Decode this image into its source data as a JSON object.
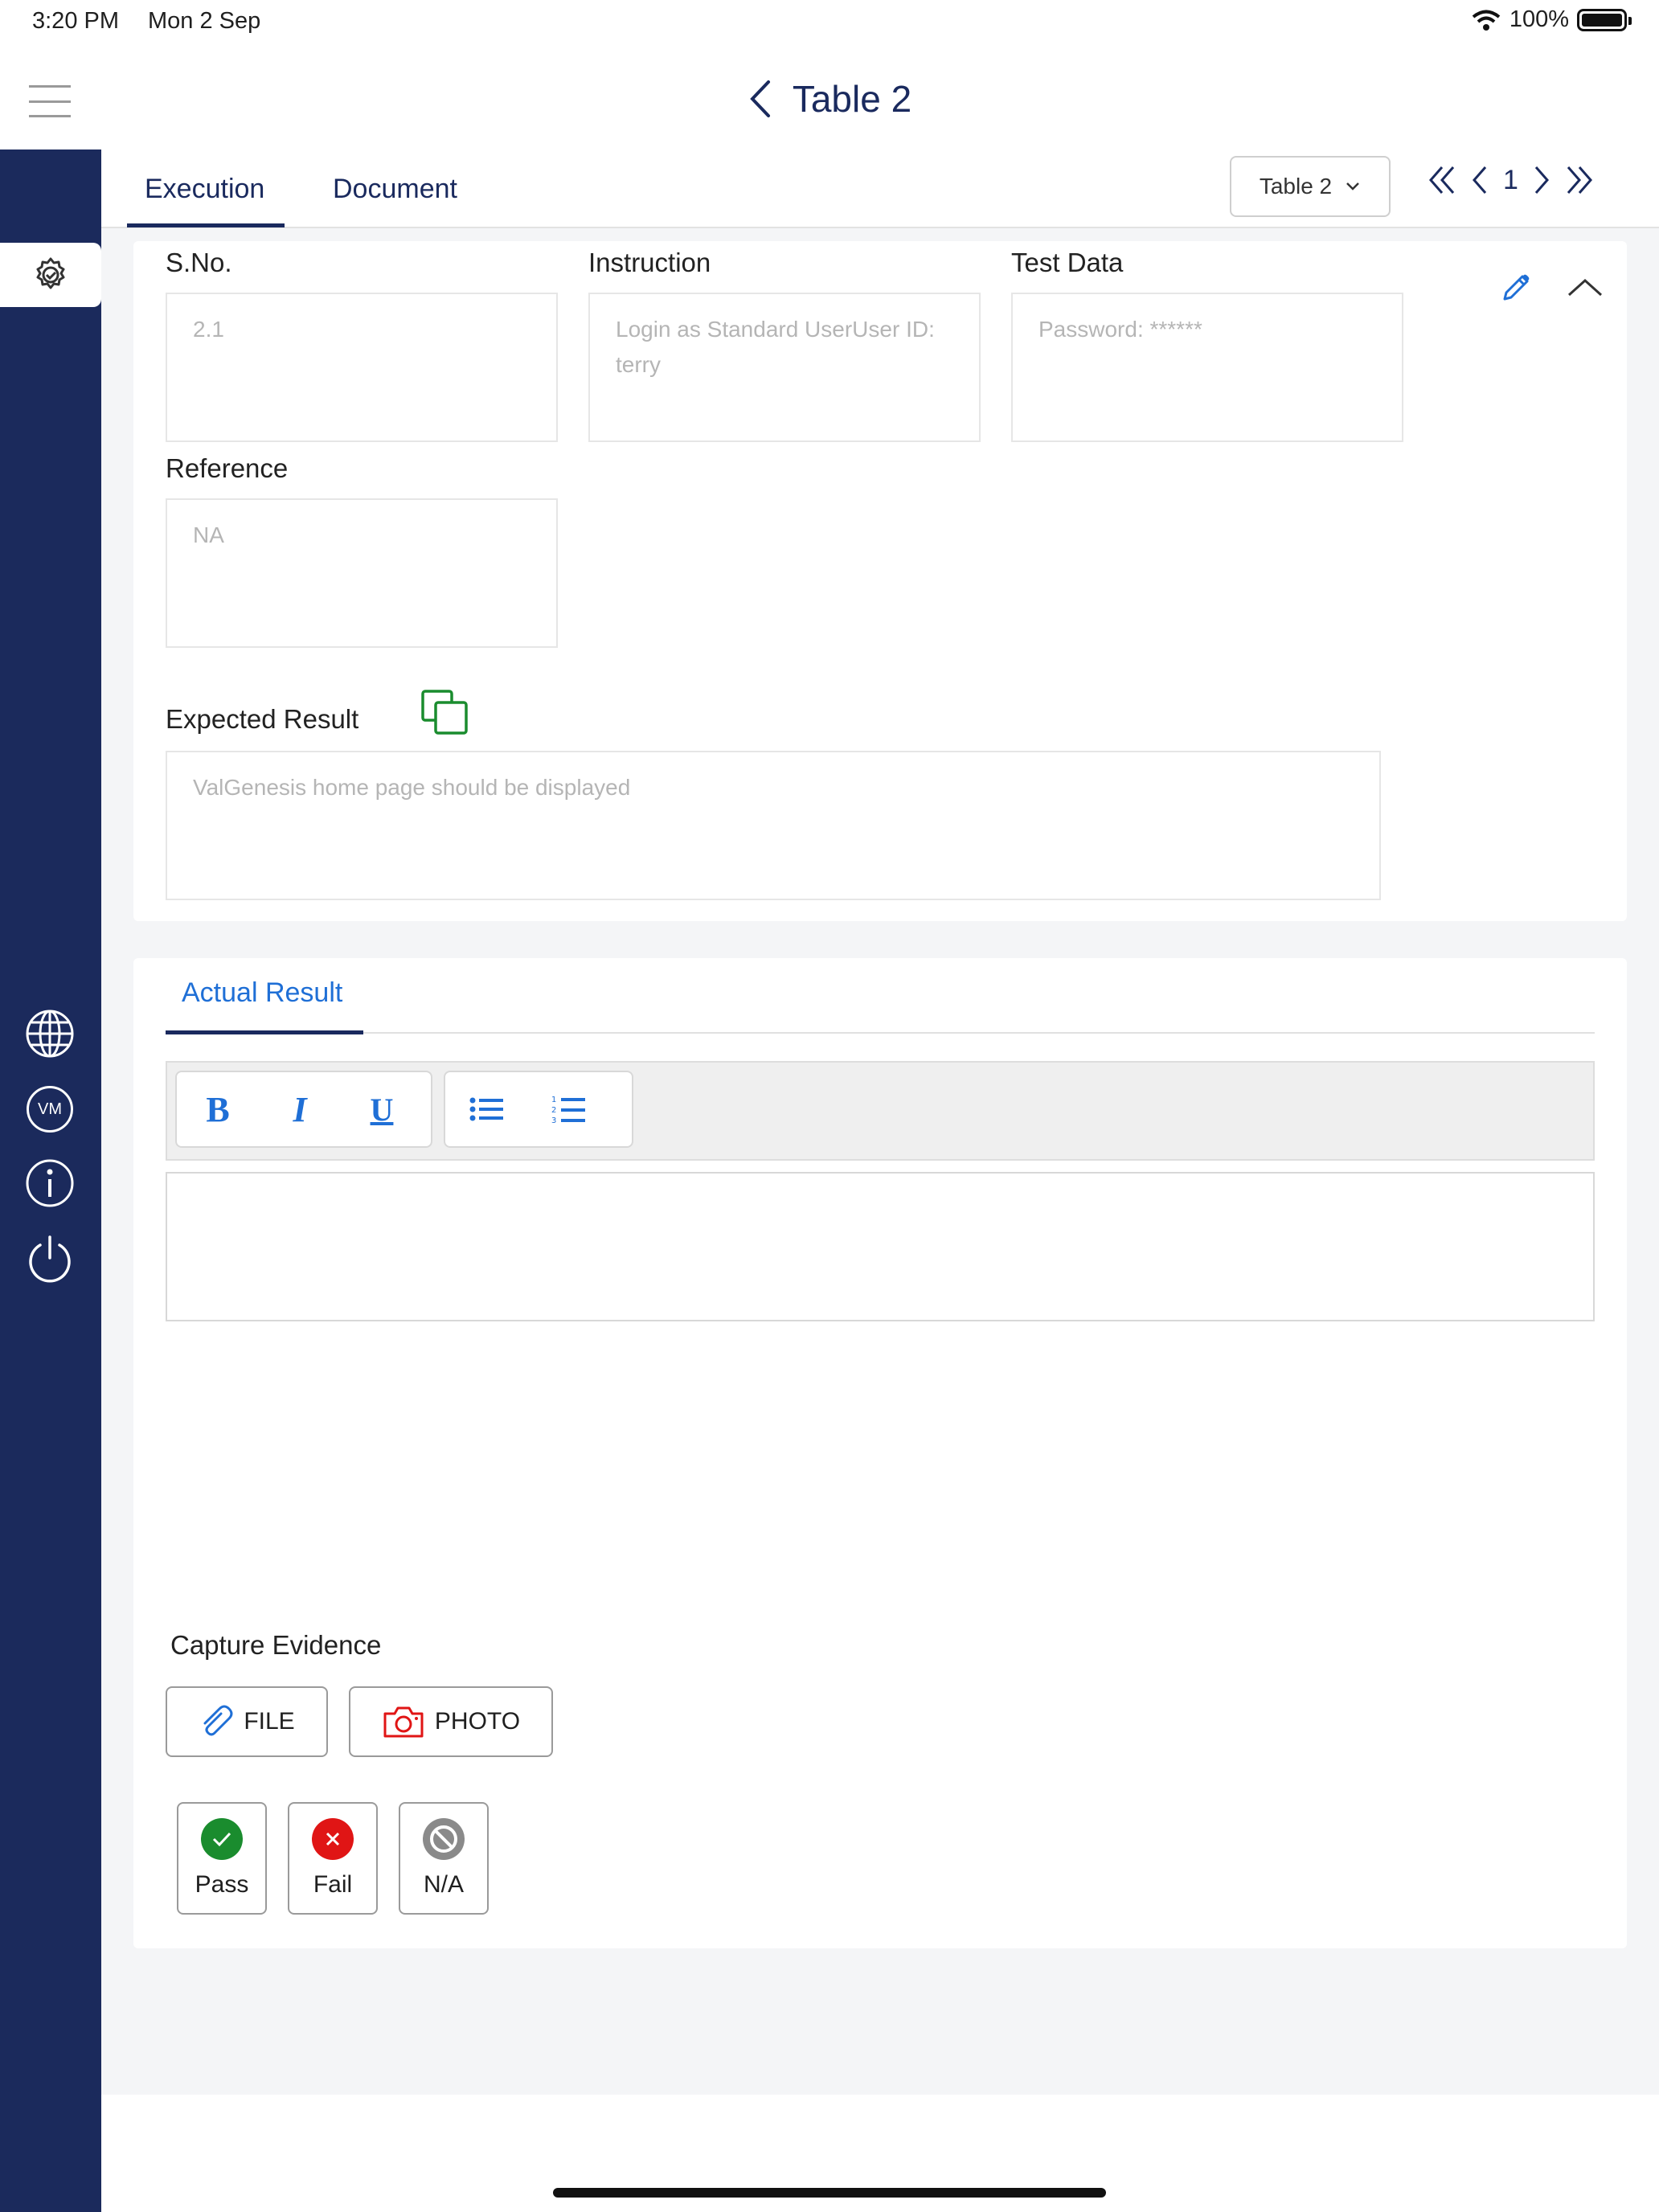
{
  "status_bar": {
    "time": "3:20 PM",
    "date": "Mon 2 Sep",
    "battery": "100%"
  },
  "nav": {
    "title": "Table 2"
  },
  "tabs": [
    {
      "label": "Execution"
    },
    {
      "label": "Document"
    }
  ],
  "table_select": {
    "value": "Table 2"
  },
  "pager": {
    "page": "1"
  },
  "step": {
    "sno_label": "S.No.",
    "sno_value": "2.1",
    "instruction_label": "Instruction",
    "instruction_value": "Login as Standard UserUser ID: terry",
    "test_data_label": "Test Data",
    "test_data_value": "Password: ******",
    "reference_label": "Reference",
    "reference_value": "NA",
    "expected_label": "Expected Result",
    "expected_value": "ValGenesis home page should be displayed"
  },
  "actual_result": {
    "tab_label": "Actual Result",
    "toolbar": {
      "bold": "B",
      "italic": "I",
      "underline": "U"
    },
    "editor_value": ""
  },
  "evidence": {
    "label": "Capture Evidence",
    "file_label": "FILE",
    "photo_label": "PHOTO"
  },
  "result_buttons": {
    "pass": "Pass",
    "fail": "Fail",
    "na": "N/A"
  },
  "sidebar": {
    "vm_label": "VM"
  },
  "colors": {
    "sidebar": "#1b2a5c",
    "accent": "#1f6fd6",
    "pass": "#1a8c2e",
    "fail": "#e01515",
    "na": "#8a8a8a"
  }
}
